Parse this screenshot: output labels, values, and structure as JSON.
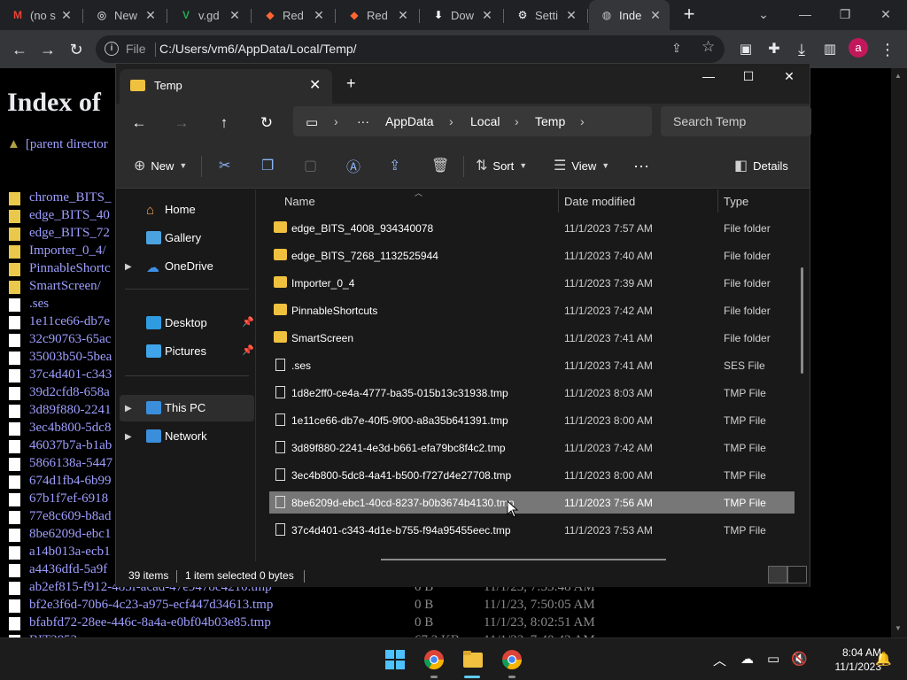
{
  "browser": {
    "tabs": [
      {
        "title": "(no s",
        "icon": "gmail-icon",
        "glyph": "M",
        "color": "#ea4335"
      },
      {
        "title": "New",
        "icon": "github-icon",
        "glyph": "◎",
        "color": "#ffffff"
      },
      {
        "title": "v.gd",
        "icon": "vgd-icon",
        "glyph": "V",
        "color": "#22aa55"
      },
      {
        "title": "Red",
        "icon": "reddit-icon",
        "glyph": "◆",
        "color": "#ff6633"
      },
      {
        "title": "Red",
        "icon": "reddit-icon",
        "glyph": "◆",
        "color": "#ff6633"
      },
      {
        "title": "Dow",
        "icon": "download-icon",
        "glyph": "⬇",
        "color": "#ffffff"
      },
      {
        "title": "Setti",
        "icon": "settings-icon",
        "glyph": "⚙",
        "color": "#ffffff"
      },
      {
        "title": "Inde",
        "icon": "globe-icon",
        "glyph": "◍",
        "color": "#bdc1c6",
        "active": true
      }
    ],
    "scheme_label": "File",
    "url": "C:/Users/vm6/AppData/Local/Temp/",
    "profile_initial": "a"
  },
  "page": {
    "title": "Index of",
    "parent_link": "[parent director",
    "entries": [
      {
        "name": "chrome_BITS_",
        "kind": "folder"
      },
      {
        "name": "edge_BITS_40",
        "kind": "folder"
      },
      {
        "name": "edge_BITS_72",
        "kind": "folder"
      },
      {
        "name": "Importer_0_4/",
        "kind": "folder"
      },
      {
        "name": "PinnableShortc",
        "kind": "folder"
      },
      {
        "name": "SmartScreen/",
        "kind": "folder"
      },
      {
        "name": ".ses",
        "kind": "file"
      },
      {
        "name": "1e11ce66-db7e",
        "kind": "file"
      },
      {
        "name": "32c90763-65ac",
        "kind": "file"
      },
      {
        "name": "35003b50-5bea",
        "kind": "file"
      },
      {
        "name": "37c4d401-c343",
        "kind": "file"
      },
      {
        "name": "39d2cfd8-658a",
        "kind": "file"
      },
      {
        "name": "3d89f880-2241",
        "kind": "file"
      },
      {
        "name": "3ec4b800-5dc8",
        "kind": "file"
      },
      {
        "name": "46037b7a-b1ab",
        "kind": "file"
      },
      {
        "name": "5866138a-5447",
        "kind": "file"
      },
      {
        "name": "674d1fb4-6b99",
        "kind": "file"
      },
      {
        "name": "67b1f7ef-6918",
        "kind": "file"
      },
      {
        "name": "77e8c609-b8ad",
        "kind": "file"
      },
      {
        "name": "8be6209d-ebc1",
        "kind": "file"
      },
      {
        "name": "a14b013a-ecb1",
        "kind": "file"
      },
      {
        "name": "a4436dfd-5a9f",
        "kind": "file"
      },
      {
        "name": "ab2ef815-f912-483f-acad-47e9478c4210.tmp",
        "kind": "file",
        "size": "0 B",
        "date": "11/1/23, 7:53:48 AM"
      },
      {
        "name": "bf2e3f6d-70b6-4c23-a975-ecf447d34613.tmp",
        "kind": "file",
        "size": "0 B",
        "date": "11/1/23, 7:50:05 AM"
      },
      {
        "name": "bfabfd72-28ee-446c-8a4a-e0bf04b03e85.tmp",
        "kind": "file",
        "size": "0 B",
        "date": "11/1/23, 8:02:51 AM"
      },
      {
        "name": "BIT3852...",
        "kind": "file",
        "size": "67.2 KB",
        "date": "11/1/23, 7:40:42 AM"
      }
    ]
  },
  "explorer": {
    "tab_title": "Temp",
    "breadcrumb": [
      "AppData",
      "Local",
      "Temp"
    ],
    "search_placeholder": "Search Temp",
    "commands": {
      "new": "New",
      "sort": "Sort",
      "view": "View",
      "details": "Details"
    },
    "nav": {
      "home": "Home",
      "gallery": "Gallery",
      "onedrive": "OneDrive",
      "desktop": "Desktop",
      "pictures": "Pictures",
      "thispc": "This PC",
      "network": "Network"
    },
    "columns": {
      "name": "Name",
      "date": "Date modified",
      "type": "Type"
    },
    "files": [
      {
        "name": "edge_BITS_4008_934340078",
        "date": "11/1/2023 7:57 AM",
        "type": "File folder",
        "kind": "folder"
      },
      {
        "name": "edge_BITS_7268_1132525944",
        "date": "11/1/2023 7:40 AM",
        "type": "File folder",
        "kind": "folder"
      },
      {
        "name": "Importer_0_4",
        "date": "11/1/2023 7:39 AM",
        "type": "File folder",
        "kind": "folder"
      },
      {
        "name": "PinnableShortcuts",
        "date": "11/1/2023 7:42 AM",
        "type": "File folder",
        "kind": "folder"
      },
      {
        "name": "SmartScreen",
        "date": "11/1/2023 7:41 AM",
        "type": "File folder",
        "kind": "folder"
      },
      {
        "name": ".ses",
        "date": "11/1/2023 7:41 AM",
        "type": "SES File",
        "kind": "file"
      },
      {
        "name": "1d8e2ff0-ce4a-4777-ba35-015b13c31938.tmp",
        "date": "11/1/2023 8:03 AM",
        "type": "TMP File",
        "kind": "file"
      },
      {
        "name": "1e11ce66-db7e-40f5-9f00-a8a35b641391.tmp",
        "date": "11/1/2023 8:00 AM",
        "type": "TMP File",
        "kind": "file"
      },
      {
        "name": "3d89f880-2241-4e3d-b661-efa79bc8f4c2.tmp",
        "date": "11/1/2023 7:42 AM",
        "type": "TMP File",
        "kind": "file"
      },
      {
        "name": "3ec4b800-5dc8-4a41-b500-f727d4e27708.tmp",
        "date": "11/1/2023 8:00 AM",
        "type": "TMP File",
        "kind": "file"
      },
      {
        "name": "8be6209d-ebc1-40cd-8237-b0b3674b4130.tmp",
        "date": "11/1/2023 7:56 AM",
        "type": "TMP File",
        "kind": "file",
        "selected": true
      },
      {
        "name": "37c4d401-c343-4d1e-b755-f94a95455eec.tmp",
        "date": "11/1/2023 7:53 AM",
        "type": "TMP File",
        "kind": "file"
      }
    ],
    "status": {
      "items": "39 items",
      "selected": "1 item selected",
      "bytes": "0 bytes"
    }
  },
  "taskbar": {
    "time": "8:04 AM",
    "date": "11/1/2023"
  }
}
